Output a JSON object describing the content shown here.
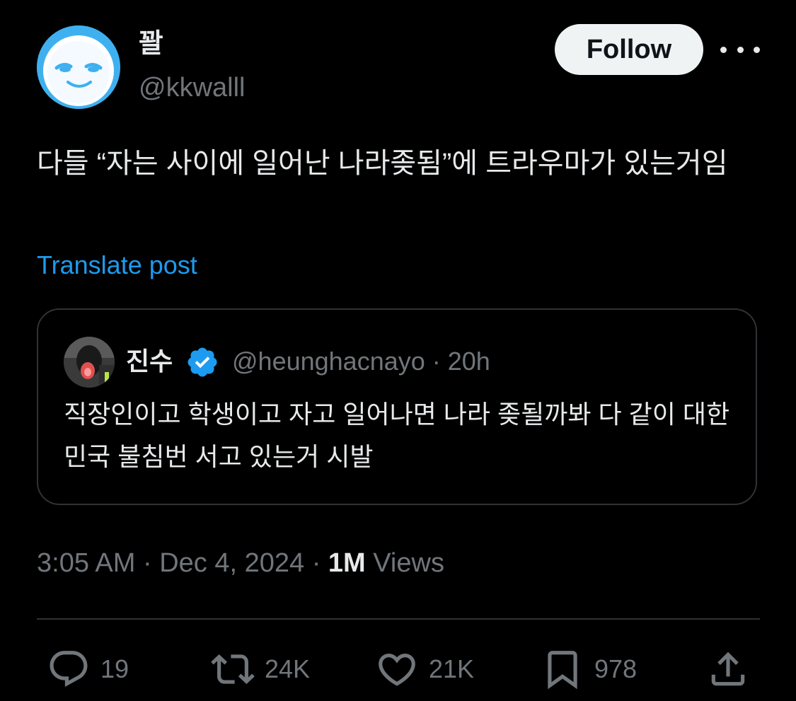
{
  "author": {
    "display_name": "꽐",
    "handle": "@kkwalll",
    "avatar_icon": "smiling-face-avatar"
  },
  "follow_button": {
    "label": "Follow"
  },
  "more_icon": "more-horizontal-icon",
  "post": {
    "text": "다들 “자는 사이에 일어난 나라좆됨”에 트라우마가 있는거임",
    "translate_label": "Translate post"
  },
  "quoted_post": {
    "display_name": "진수",
    "verified": true,
    "handle_time": "@heunghacnayo · 20h",
    "text": "직장인이고 학생이고 자고 일어나면 나라 좆될까봐 다 같이 대한민국 불침번 서고 있는거 시발"
  },
  "meta": {
    "time": "3:05 AM",
    "date": "Dec 4, 2024",
    "separator": "·",
    "views_count": "1M",
    "views_label": "Views"
  },
  "actions": {
    "replies": "19",
    "reposts": "24K",
    "likes": "21K",
    "bookmarks": "978"
  },
  "colors": {
    "background": "#000000",
    "text_primary": "#e7e9ea",
    "text_secondary": "#71767b",
    "link": "#1d9bf0",
    "border": "#2f3336",
    "verified": "#1d9bf0"
  }
}
